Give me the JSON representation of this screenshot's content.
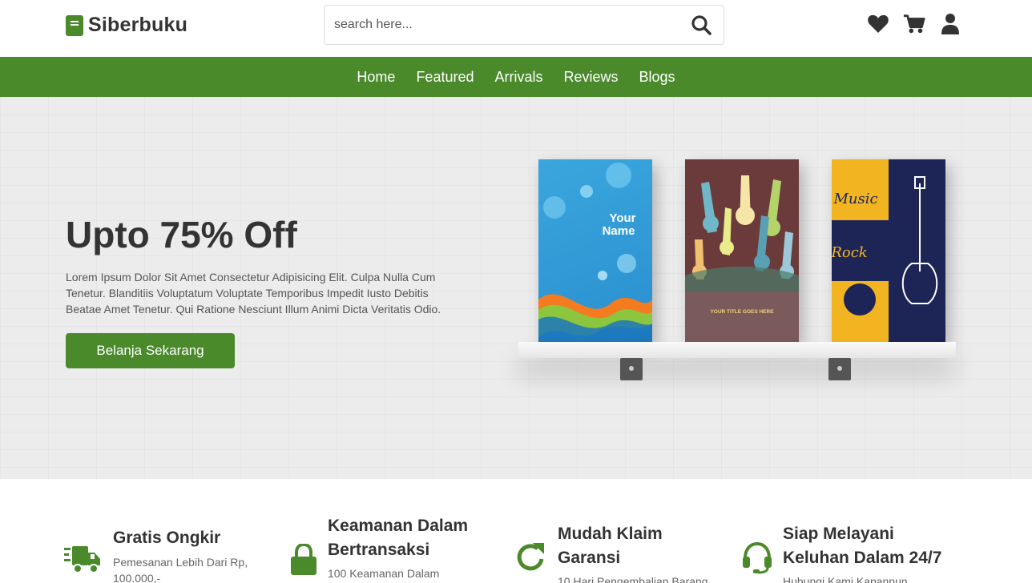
{
  "header": {
    "logo_text": "Siberbuku",
    "search_placeholder": "search here...",
    "icons": [
      "heart-icon",
      "cart-icon",
      "user-icon"
    ]
  },
  "nav": {
    "items": [
      {
        "label": "Home"
      },
      {
        "label": "Featured"
      },
      {
        "label": "Arrivals"
      },
      {
        "label": "Reviews"
      },
      {
        "label": "Blogs"
      }
    ]
  },
  "hero": {
    "title": "Upto 75% Off",
    "description_lines": [
      "Lorem Ipsum Dolor Sit Amet Consectetur Adipisicing Elit. Culpa Nulla Cum",
      "Tenetur. Blanditiis Voluptatum Voluptate Temporibus Impedit Iusto Debitis",
      "Beatae Amet Tenetur. Qui Ratione Nesciunt Illum Animi Dicta Veritatis Odio."
    ],
    "button_label": "Belanja Sekarang",
    "books": [
      {
        "cover_text_1": "Your",
        "cover_text_2": "Name"
      },
      {
        "cover_text_1": "YOUR TITLE GOES HERE"
      },
      {
        "cover_text_1": "Music",
        "cover_text_2": "Rock"
      }
    ]
  },
  "features": [
    {
      "icon": "truck-icon",
      "title_lines": [
        "Gratis Ongkir"
      ],
      "desc_lines": [
        "Pemesanan Lebih Dari Rp,",
        "100.000,-"
      ]
    },
    {
      "icon": "lock-icon",
      "title_lines": [
        "Keamanan Dalam",
        "Bertransaksi"
      ],
      "desc_lines": [
        "100 Keamanan Dalam"
      ]
    },
    {
      "icon": "redo-icon",
      "title_lines": [
        "Mudah Klaim",
        "Garansi"
      ],
      "desc_lines": [
        "10 Hari Pengembalian Barang"
      ]
    },
    {
      "icon": "headset-icon",
      "title_lines": [
        "Siap Melayani",
        "Keluhan Dalam 24/7"
      ],
      "desc_lines": [
        "Hubungi Kami Kapanpun"
      ]
    }
  ],
  "colors": {
    "brand": "#4a8a2b",
    "text": "#333333"
  }
}
